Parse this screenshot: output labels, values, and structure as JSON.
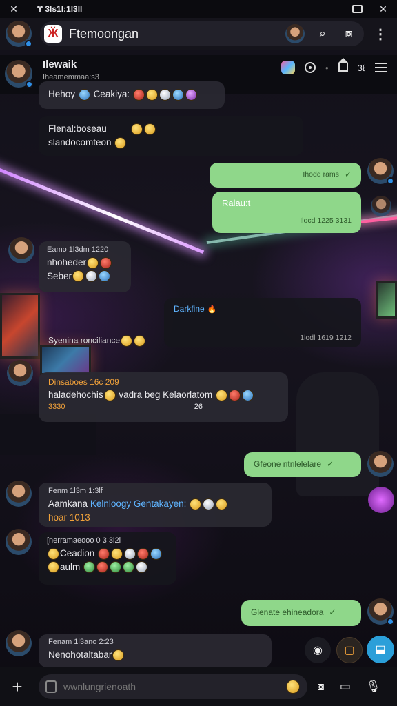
{
  "status_bar": {
    "text": "Ɏ 3ls1l:1l3ll"
  },
  "app_bar": {
    "title": "Ftemoongan"
  },
  "group": {
    "name": "Ilewaik",
    "subtitle": "Iheamemmaa:s3",
    "count": "3ℓ"
  },
  "messages": {
    "m1": {
      "text": "Hehoy",
      "mention": "Ceakiya:"
    },
    "m2": {
      "line1": "Flenal:boseau",
      "line2": "slandocomteon"
    },
    "m3": {
      "text": "Ihodd rams"
    },
    "m4": {
      "text": "Ralau:t",
      "time": "Ilocd 1225 3131"
    },
    "m5": {
      "sender": "Eamo 1l3dm 1220",
      "line1": "nhoheder",
      "line2": "Seber"
    },
    "m6": {
      "title": "Darkfine",
      "footer_left": "Syenina ronciliance",
      "time": "1lodl 1619 1212"
    },
    "m7": {
      "sender": "Dinsaboes 16c 209",
      "line1": "haladehochis",
      "line1b": "vadra beg Kelaorlatom",
      "count_left": "3330",
      "count_right": "26"
    },
    "m8": {
      "text": "Gfeone ntnlelelare"
    },
    "m9": {
      "sender": "Fenm 1l3m 1:3lf",
      "lead": "Aamkana",
      "mention": "Kelnloogy Gentakayen:",
      "line2": "hoar 1013"
    },
    "m10": {
      "sender": "[nerramaeooo 0 3 3l2l",
      "row1": "Ceadion",
      "row2": "aulm"
    },
    "m11": {
      "text": "Glenate ehineadora"
    },
    "m12": {
      "sender": "Fenam 1l3ano 2:23",
      "text": "Nenohotaltabar"
    }
  },
  "composer": {
    "placeholder": "wwnlungrienoath"
  },
  "colors": {
    "outgoing": "#8fd78a",
    "incoming": "#2a2931",
    "accent": "#2b9fd9",
    "orange": "#f2a23a"
  }
}
